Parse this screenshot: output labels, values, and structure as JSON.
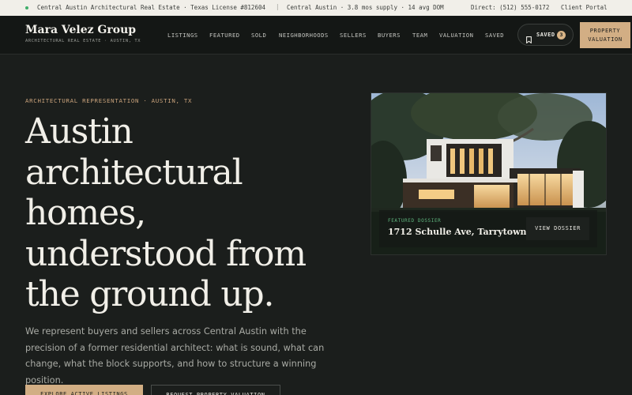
{
  "topbar": {
    "tagline": "Central Austin Architectural Real Estate · Texas License #812604",
    "separator": "|",
    "market": "Central Austin · 3.8 mos supply · 14 avg DOM",
    "phone": "Direct: (512) 555-0172",
    "portal": "Client Portal",
    "status_color": "#3fae6a"
  },
  "header": {
    "brand_name": "Mara Velez Group",
    "brand_sub": "ARCHITECTURAL REAL ESTATE · AUSTIN, TX",
    "nav": [
      "LISTINGS",
      "FEATURED",
      "SOLD",
      "NEIGHBORHOODS",
      "SELLERS",
      "BUYERS",
      "TEAM",
      "VALUATION",
      "SAVED"
    ],
    "saved_label": "SAVED",
    "saved_count": "3",
    "valuation_line1": "PROPERTY",
    "valuation_line2": "VALUATION"
  },
  "hero": {
    "eyebrow": "ARCHITECTURAL REPRESENTATION · AUSTIN, TX",
    "headline_lines": [
      "Austin",
      "architectural",
      "homes,",
      "understood from",
      "the ground up."
    ],
    "lead": "We represent buyers and sellers across Central Austin with the precision of a former residential architect: what is sound, what can change, what the block supports, and how to structure a winning position.",
    "primary_cta": "EXPLORE ACTIVE LISTINGS",
    "secondary_cta": "REQUEST PROPERTY VALUATION"
  },
  "featured": {
    "tag": "FEATURED DOSSIER",
    "address": "1712 Schulle Ave, Tarrytown",
    "view_label": "VIEW DOSSIER"
  },
  "colors": {
    "accent": "#d2ae84",
    "background": "#1b1e1c",
    "featured_tag": "#5fb57e"
  }
}
